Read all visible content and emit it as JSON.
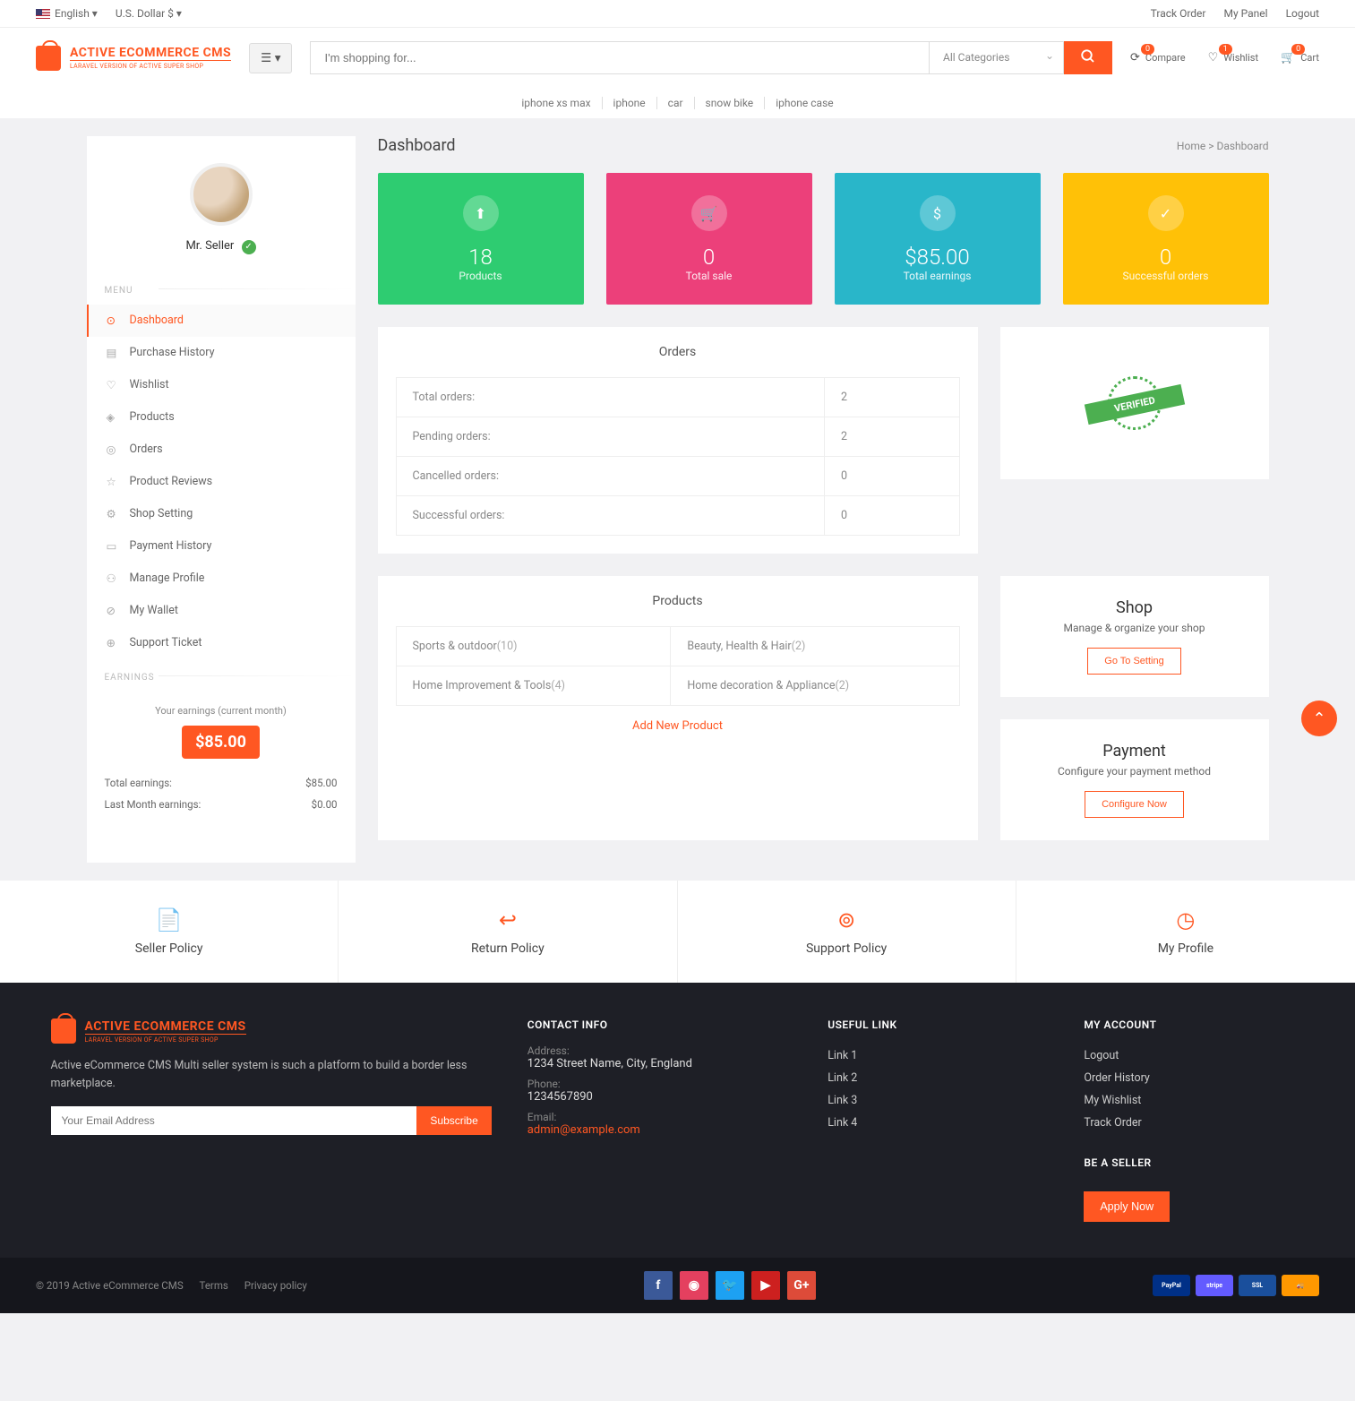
{
  "topbar": {
    "language": "English",
    "currency": "U.S. Dollar $",
    "track_order": "Track Order",
    "my_panel": "My Panel",
    "logout": "Logout"
  },
  "logo": {
    "title": "ACTIVE ECOMMERCE CMS",
    "subtitle": "LARAVEL VERSION OF ACTIVE SUPER SHOP"
  },
  "search": {
    "placeholder": "I'm shopping for...",
    "category": "All Categories"
  },
  "header_icons": {
    "compare": {
      "label": "Compare",
      "count": "0"
    },
    "wishlist": {
      "label": "Wishlist",
      "count": "1"
    },
    "cart": {
      "label": "Cart",
      "count": "0"
    }
  },
  "nav": [
    "iphone xs max",
    "iphone",
    "car",
    "snow bike",
    "iphone case"
  ],
  "profile": {
    "name": "Mr. Seller"
  },
  "menu_label": "MENU",
  "menu": [
    {
      "icon": "⊙",
      "label": "Dashboard",
      "active": true
    },
    {
      "icon": "▤",
      "label": "Purchase History"
    },
    {
      "icon": "♡",
      "label": "Wishlist"
    },
    {
      "icon": "◈",
      "label": "Products"
    },
    {
      "icon": "◎",
      "label": "Orders"
    },
    {
      "icon": "☆",
      "label": "Product Reviews"
    },
    {
      "icon": "⚙",
      "label": "Shop Setting"
    },
    {
      "icon": "▭",
      "label": "Payment History"
    },
    {
      "icon": "⚇",
      "label": "Manage Profile"
    },
    {
      "icon": "⊘",
      "label": "My Wallet"
    },
    {
      "icon": "⊕",
      "label": "Support Ticket"
    }
  ],
  "earnings_label": "EARNINGS",
  "earnings": {
    "current_label": "Your earnings (current month)",
    "current": "$85.00",
    "rows": [
      {
        "label": "Total earnings:",
        "value": "$85.00"
      },
      {
        "label": "Last Month earnings:",
        "value": "$0.00"
      }
    ]
  },
  "page": {
    "title": "Dashboard",
    "breadcrumb_home": "Home",
    "breadcrumb_current": "Dashboard"
  },
  "stats": [
    {
      "color": "#2ecc71",
      "icon": "⬆",
      "num": "18",
      "label": "Products"
    },
    {
      "color": "#ec407a",
      "icon": "🛒",
      "num": "0",
      "label": "Total sale"
    },
    {
      "color": "#29b6c9",
      "icon": "$",
      "num": "$85.00",
      "label": "Total earnings"
    },
    {
      "color": "#ffc107",
      "icon": "✓",
      "num": "0",
      "label": "Successful orders"
    }
  ],
  "orders_panel": {
    "title": "Orders",
    "rows": [
      {
        "label": "Total orders:",
        "value": "2"
      },
      {
        "label": "Pending orders:",
        "value": "2"
      },
      {
        "label": "Cancelled orders:",
        "value": "0"
      },
      {
        "label": "Successful orders:",
        "value": "0"
      }
    ]
  },
  "verified_text": "VERIFIED",
  "products_panel": {
    "title": "Products",
    "cells": [
      {
        "name": "Sports & outdoor",
        "count": "(10)"
      },
      {
        "name": "Beauty, Health & Hair",
        "count": "(2)"
      },
      {
        "name": "Home Improvement & Tools",
        "count": "(4)"
      },
      {
        "name": "Home decoration & Appliance",
        "count": "(2)"
      }
    ],
    "add_link": "Add New Product"
  },
  "shop_panel": {
    "title": "Shop",
    "sub": "Manage & organize your shop",
    "btn": "Go To Setting"
  },
  "payment_panel": {
    "title": "Payment",
    "sub": "Configure your payment method",
    "btn": "Configure Now"
  },
  "footer_links": [
    {
      "icon": "📄",
      "label": "Seller Policy"
    },
    {
      "icon": "↩",
      "label": "Return Policy"
    },
    {
      "icon": "⊚",
      "label": "Support Policy"
    },
    {
      "icon": "◷",
      "label": "My Profile"
    }
  ],
  "footer": {
    "desc": "Active eCommerce CMS Multi seller system is such a platform to build a border less marketplace.",
    "email_placeholder": "Your Email Address",
    "subscribe": "Subscribe",
    "contact_title": "CONTACT INFO",
    "address_label": "Address:",
    "address": "1234 Street Name, City, England",
    "phone_label": "Phone:",
    "phone": "1234567890",
    "email_label": "Email:",
    "email": "admin@example.com",
    "useful_title": "USEFUL LINK",
    "useful": [
      "Link 1",
      "Link 2",
      "Link 3",
      "Link 4"
    ],
    "account_title": "MY ACCOUNT",
    "account": [
      "Logout",
      "Order History",
      "My Wishlist",
      "Track Order"
    ],
    "seller_title": "BE A SELLER",
    "apply": "Apply Now"
  },
  "bottom": {
    "copyright": "© 2019 Active eCommerce CMS",
    "terms": "Terms",
    "privacy": "Privacy policy"
  }
}
